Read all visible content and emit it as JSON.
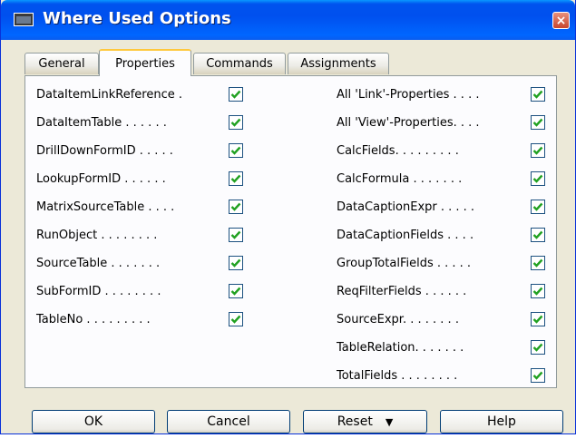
{
  "window": {
    "title": "Where Used Options",
    "close_glyph": "×"
  },
  "tabs": [
    {
      "label": "General",
      "active": false
    },
    {
      "label": "Properties",
      "active": true
    },
    {
      "label": "Commands",
      "active": false
    },
    {
      "label": "Assignments",
      "active": false
    }
  ],
  "left_options": [
    {
      "label": "DataItemLinkReference  .",
      "checked": true
    },
    {
      "label": "DataItemTable  .  .  .  .  .  .",
      "checked": true
    },
    {
      "label": "DrillDownFormID  .  .  .  .  .",
      "checked": true
    },
    {
      "label": "LookupFormID  .  .  .  .  .  .",
      "checked": true
    },
    {
      "label": "MatrixSourceTable  .  .  .  .",
      "checked": true
    },
    {
      "label": "RunObject  .  .  .  .  .  .  .  .",
      "checked": true
    },
    {
      "label": "SourceTable  .  .  .  .  .  .  .",
      "checked": true
    },
    {
      "label": "SubFormID  .  .  .  .  .  .  .  .",
      "checked": true
    },
    {
      "label": "TableNo  .  .  .  .  .  .  .  .  .",
      "checked": true
    }
  ],
  "right_options": [
    {
      "label": "All 'Link'-Properties  .  .  .  .",
      "checked": true
    },
    {
      "label": "All 'View'-Properties.  .  .  .",
      "checked": true
    },
    {
      "label": "CalcFields.  .  .  .  .  .  .  .  .",
      "checked": true
    },
    {
      "label": "CalcFormula  .  .  .  .  .  .  .",
      "checked": true
    },
    {
      "label": "DataCaptionExpr  .  .  .  .  .",
      "checked": true
    },
    {
      "label": "DataCaptionFields  .  .  .  .",
      "checked": true
    },
    {
      "label": "GroupTotalFields  .  .  .  .  .",
      "checked": true
    },
    {
      "label": "ReqFilterFields  .  .  .  .  .  .",
      "checked": true
    },
    {
      "label": "SourceExpr.  .  .  .  .  .  .  .",
      "checked": true
    },
    {
      "label": "TableRelation.  .  .  .  .  .  .",
      "checked": true
    },
    {
      "label": "TotalFields  .  .  .  .  .  .  .  .",
      "checked": true
    }
  ],
  "buttons": {
    "ok": "OK",
    "cancel": "Cancel",
    "reset": "Reset",
    "help": "Help"
  },
  "colors": {
    "checkmark": "#21a121",
    "titlebar": "#0054e3",
    "active_tab_accent": "#ffc83c"
  }
}
